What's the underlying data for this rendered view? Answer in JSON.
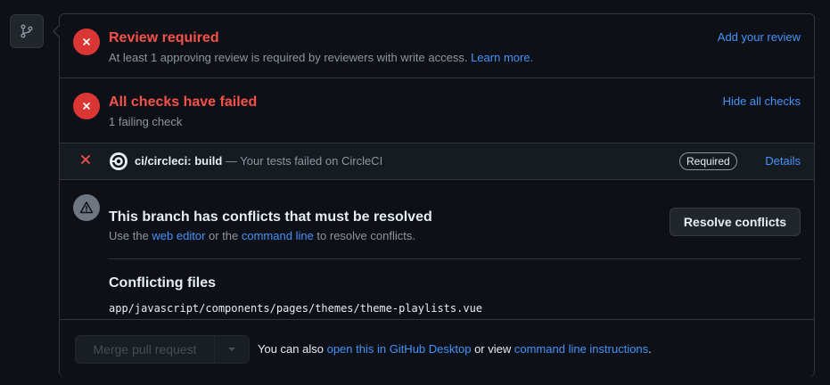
{
  "review": {
    "title": "Review required",
    "desc": "At least 1 approving review is required by reviewers with write access.",
    "learn_more": "Learn more.",
    "action": "Add your review"
  },
  "checks": {
    "title": "All checks have failed",
    "desc": "1 failing check",
    "action": "Hide all checks",
    "items": [
      {
        "name": "ci/circleci: build",
        "desc": " — Your tests failed on CircleCI",
        "badge": "Required",
        "action": "Details",
        "icon": "circleci-logo-icon",
        "status_icon": "x-icon"
      }
    ]
  },
  "conflicts": {
    "title": "This branch has conflicts that must be resolved",
    "desc_prefix": "Use the ",
    "web_editor": "web editor",
    "desc_mid": " or the ",
    "command_line": "command line",
    "desc_suffix": " to resolve conflicts.",
    "button": "Resolve conflicts",
    "files_title": "Conflicting files",
    "files": [
      "app/javascript/components/pages/themes/theme-playlists.vue"
    ]
  },
  "merge": {
    "button": "Merge pull request",
    "note_prefix": "You can also ",
    "open_desktop": "open this in GitHub Desktop",
    "note_mid": " or view ",
    "cli_instructions": "command line instructions",
    "note_suffix": "."
  },
  "colors": {
    "background": "#0d1117",
    "danger": "#f85149",
    "danger_fill": "#da3633",
    "link": "#4493f8",
    "border": "#30363d",
    "muted": "#8d96a0"
  }
}
